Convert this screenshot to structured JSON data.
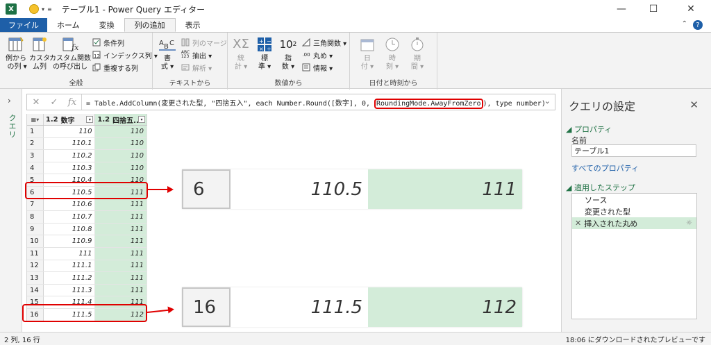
{
  "window": {
    "title": "テーブル1 - Power Query エディター",
    "minimize": "—",
    "maximize": "☐",
    "close": "✕"
  },
  "tabs": [
    "ファイル",
    "ホーム",
    "変換",
    "列の追加",
    "表示"
  ],
  "ribbon": {
    "general": {
      "label": "全般",
      "col_from_examples": "例から\n の列 ▾",
      "custom_col": "カスタ\nム列",
      "invoke_custom_fn": "カスタム関数\nの呼び出し",
      "conditional_col": "条件列",
      "index_col": "インデックス列 ▾",
      "duplicate_col": "重複する列"
    },
    "text": {
      "label": "テキストから",
      "format": "書\n式 ▾",
      "merge_cols": "列のマージ",
      "extract": "抽出 ▾",
      "parse": "解析 ▾"
    },
    "number": {
      "label": "数値から",
      "statistics": "統\n計 ▾",
      "standard": "標\n準 ▾",
      "scientific": "指\n数 ▾",
      "trig": "三角関数 ▾",
      "rounding": "丸め ▾",
      "information": "情報 ▾"
    },
    "datetime": {
      "label": "日付と時刻から",
      "date": "日\n付 ▾",
      "time": "時\n刻 ▾",
      "duration": "期\n間 ▾"
    }
  },
  "queries_strip": {
    "label": "クエリ"
  },
  "formula_bar": {
    "formula_prefix": "= Table.AddColumn(変更された型, \"四捨五入\", each Number.Round([数字], 0, ",
    "formula_highlight": "RoundingMode.AwayFromZero",
    "formula_suffix": "), type number)"
  },
  "grid": {
    "columns": [
      {
        "type": "1.2",
        "name": "数字"
      },
      {
        "type": "1.2",
        "name": "四捨五..."
      }
    ],
    "rows": [
      {
        "n": "1",
        "a": "110",
        "b": "110"
      },
      {
        "n": "2",
        "a": "110.1",
        "b": "110"
      },
      {
        "n": "3",
        "a": "110.2",
        "b": "110"
      },
      {
        "n": "4",
        "a": "110.3",
        "b": "110"
      },
      {
        "n": "5",
        "a": "110.4",
        "b": "110"
      },
      {
        "n": "6",
        "a": "110.5",
        "b": "111"
      },
      {
        "n": "7",
        "a": "110.6",
        "b": "111"
      },
      {
        "n": "8",
        "a": "110.7",
        "b": "111"
      },
      {
        "n": "9",
        "a": "110.8",
        "b": "111"
      },
      {
        "n": "10",
        "a": "110.9",
        "b": "111"
      },
      {
        "n": "11",
        "a": "111",
        "b": "111"
      },
      {
        "n": "12",
        "a": "111.1",
        "b": "111"
      },
      {
        "n": "13",
        "a": "111.2",
        "b": "111"
      },
      {
        "n": "14",
        "a": "111.3",
        "b": "111"
      },
      {
        "n": "15",
        "a": "111.4",
        "b": "111"
      },
      {
        "n": "16",
        "a": "111.5",
        "b": "112"
      }
    ]
  },
  "callouts": [
    {
      "n": "6",
      "a": "110.5",
      "b": "111"
    },
    {
      "n": "16",
      "a": "111.5",
      "b": "112"
    }
  ],
  "settings": {
    "title": "クエリの設定",
    "properties": "プロパティ",
    "name_label": "名前",
    "name_value": "テーブル1",
    "all_properties": "すべてのプロパティ",
    "applied_steps": "適用したステップ",
    "steps": [
      "ソース",
      "変更された型",
      "挿入された丸め"
    ]
  },
  "statusbar": {
    "left": "2 列, 16 行",
    "right": "18:06 にダウンロードされたプレビューです"
  },
  "colors": {
    "accent_green": "#217346",
    "file_tab": "#1e5fa8",
    "highlight_red": "#e00000",
    "selected_green": "#d3ecd9"
  }
}
